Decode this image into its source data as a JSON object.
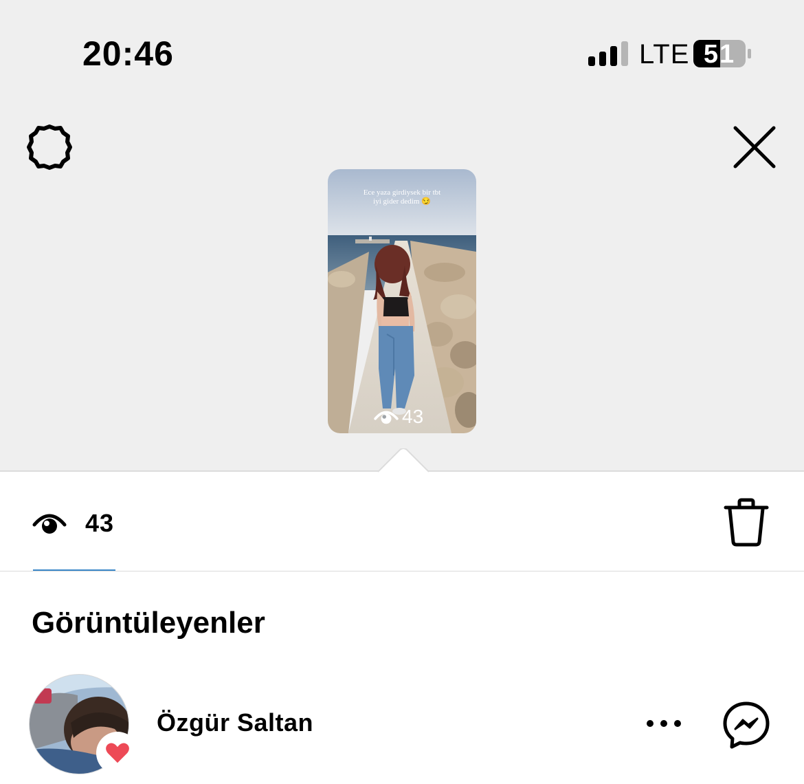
{
  "status_bar": {
    "time": "20:46",
    "network": "LTE",
    "battery": "51",
    "icons": [
      "signal-icon",
      "battery-icon"
    ]
  },
  "header": {
    "settings_icon": "gear-icon",
    "close_icon": "close-icon"
  },
  "story": {
    "caption_line1": "Ece yaza girdiysek bir tbt",
    "caption_line2": "iyi gider dedim 😏",
    "view_count": "43",
    "view_icon": "eye-icon"
  },
  "sheet": {
    "views_tab_count": "43",
    "views_tab_icon": "eye-icon",
    "delete_icon": "trash-icon",
    "section_title": "Görüntüleyenler",
    "accent_color": "#3a86c8"
  },
  "viewers": [
    {
      "name": "Özgür Saltan",
      "liked": true,
      "like_color": "#ed4956",
      "actions": [
        "more-icon",
        "messenger-icon"
      ]
    }
  ]
}
